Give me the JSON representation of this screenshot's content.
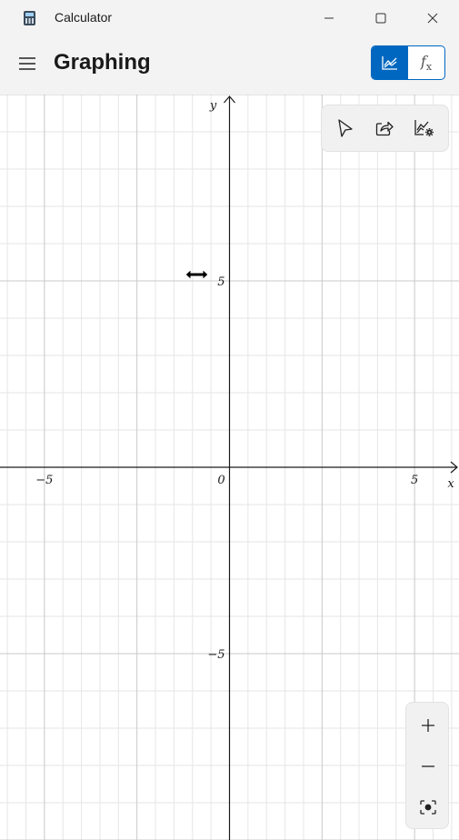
{
  "window": {
    "app_title": "Calculator",
    "icons": {
      "app": "calculator-icon",
      "minimize": "minimize-icon",
      "maximize": "maximize-icon",
      "close": "close-icon"
    }
  },
  "header": {
    "menu_icon": "hamburger-icon",
    "title": "Graphing",
    "mode_toggle": {
      "graph_icon": "graph-icon",
      "function_label": "f",
      "function_subscript": "x",
      "active": "graph"
    }
  },
  "graph_tools": [
    "select-icon",
    "share-icon",
    "graph-settings-icon"
  ],
  "graph": {
    "x_axis_label": "x",
    "y_axis_label": "y",
    "origin_label": "0",
    "x_tick_labels": [
      {
        "value": -5,
        "text": "−5"
      },
      {
        "value": 5,
        "text": "5"
      }
    ],
    "y_tick_labels": [
      {
        "value": 5,
        "text": "5"
      },
      {
        "value": -5,
        "text": "−5"
      }
    ],
    "x_range": [
      -6.2,
      6.2
    ],
    "y_range": [
      -10,
      10
    ]
  },
  "zoom_controls": [
    "zoom-in-icon",
    "zoom-out-icon",
    "reset-view-icon"
  ],
  "cursor": "resize-horizontal-cursor",
  "colors": {
    "accent": "#0067c0",
    "chrome_background": "#f3f3f3",
    "graph_background": "#ffffff",
    "axis": "#1a1a1a",
    "major_grid": "#c8c8c8",
    "minor_grid": "#e6e6e6"
  }
}
